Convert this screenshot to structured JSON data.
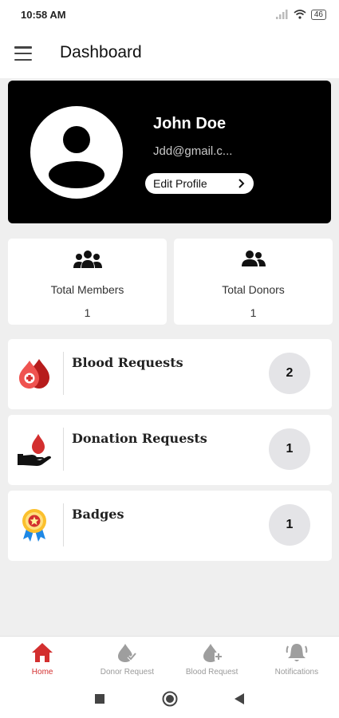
{
  "status_bar": {
    "time": "10:58 AM",
    "battery": "46"
  },
  "app_bar": {
    "title": "Dashboard",
    "menu_icon": "hamburger-menu-icon"
  },
  "profile": {
    "name": "John Doe",
    "email": "Jdd@gmail.c...",
    "edit_label": "Edit Profile",
    "avatar_icon": "person-avatar-icon"
  },
  "stats": [
    {
      "label": "Total Members",
      "value": "1",
      "icon": "group-icon"
    },
    {
      "label": "Total Donors",
      "value": "1",
      "icon": "people-icon"
    }
  ],
  "requests": [
    {
      "label": "Blood Requests",
      "count": "2",
      "icon": "blood-drop-icon"
    },
    {
      "label": "Donation Requests",
      "count": "1",
      "icon": "donation-hand-icon"
    },
    {
      "label": "Badges",
      "count": "1",
      "icon": "badge-ribbon-icon"
    }
  ],
  "bottom_nav": [
    {
      "label": "Home",
      "icon": "home-icon",
      "active": true
    },
    {
      "label": "Donor Request",
      "icon": "drop-check-icon"
    },
    {
      "label": "Blood Request",
      "icon": "drop-plus-icon"
    },
    {
      "label": "Notifications",
      "icon": "bell-icon"
    }
  ],
  "colors": {
    "accent": "#d32f2f",
    "card_dark": "#000000",
    "background": "#efefef"
  }
}
